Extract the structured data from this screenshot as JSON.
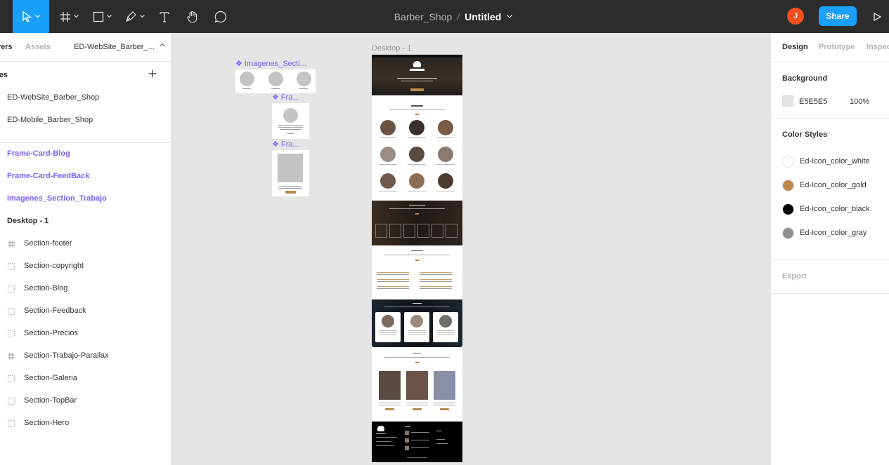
{
  "toolbar": {
    "tools": [
      {
        "name": "move-tool",
        "active": true
      },
      {
        "name": "frame-tool",
        "active": false
      },
      {
        "name": "shape-tool",
        "active": false
      },
      {
        "name": "pen-tool",
        "active": false
      },
      {
        "name": "text-tool",
        "active": false
      },
      {
        "name": "hand-tool",
        "active": false
      },
      {
        "name": "comment-tool",
        "active": false
      }
    ],
    "project_name": "Barber_Shop",
    "separator": "/",
    "file_name": "Untitled",
    "avatar_initial": "J",
    "share_label": "Share",
    "colors": {
      "bar": "#2c2c2c",
      "accent": "#18a0fb",
      "avatar": "#f24e1e"
    }
  },
  "left_panel": {
    "tabs": {
      "layers": "yers",
      "assets": "Assets"
    },
    "current_page": "ED-WebSite_Barber_...",
    "pages_header": "ges",
    "pages": [
      "ED-WebSite_Barber_Shop",
      "ED-Mobile_Barber_Shop"
    ],
    "layers": {
      "components": [
        "Frame-Card-Blog",
        "Frame-Card-FeedBack",
        "Imagenes_Section_Trabajo"
      ],
      "frame": "Desktop - 1",
      "children": [
        {
          "label": "Section-footer",
          "icon": "frame-icon"
        },
        {
          "label": "Section-copyright",
          "icon": "group-icon"
        },
        {
          "label": "Section-Blog",
          "icon": "group-icon"
        },
        {
          "label": "Section-Feedback",
          "icon": "group-icon"
        },
        {
          "label": "Section-Precios",
          "icon": "group-icon"
        },
        {
          "label": "Section-Trabajo-Parallax",
          "icon": "frame-icon"
        },
        {
          "label": "Section-Galeria",
          "icon": "group-icon"
        },
        {
          "label": "Section-TopBar",
          "icon": "group-icon"
        },
        {
          "label": "Section-Hero",
          "icon": "group-icon"
        }
      ]
    }
  },
  "canvas": {
    "background": "#e5e5e5",
    "labels": {
      "imagenes": "❖ Imagenes_Secti...",
      "frame1": "❖ Fra...",
      "frame2": "❖ Fra...",
      "desktop": "Desktop - 1"
    }
  },
  "right_panel": {
    "tabs": {
      "design": "Design",
      "prototype": "Prototype",
      "inspect": "Inspec"
    },
    "background_title": "Background",
    "background_hex": "E5E5E5",
    "background_opacity": "100%",
    "color_styles_title": "Color Styles",
    "color_styles": [
      {
        "name": "Ed-Icon_color_white",
        "color": "#ffffff"
      },
      {
        "name": "Ed-Icon_color_gold",
        "color": "#b8894a"
      },
      {
        "name": "Ed-Icon_color_black",
        "color": "#000000"
      },
      {
        "name": "Ed-Icon_color_gray",
        "color": "#8f8f8f"
      }
    ],
    "export_title": "Export"
  }
}
